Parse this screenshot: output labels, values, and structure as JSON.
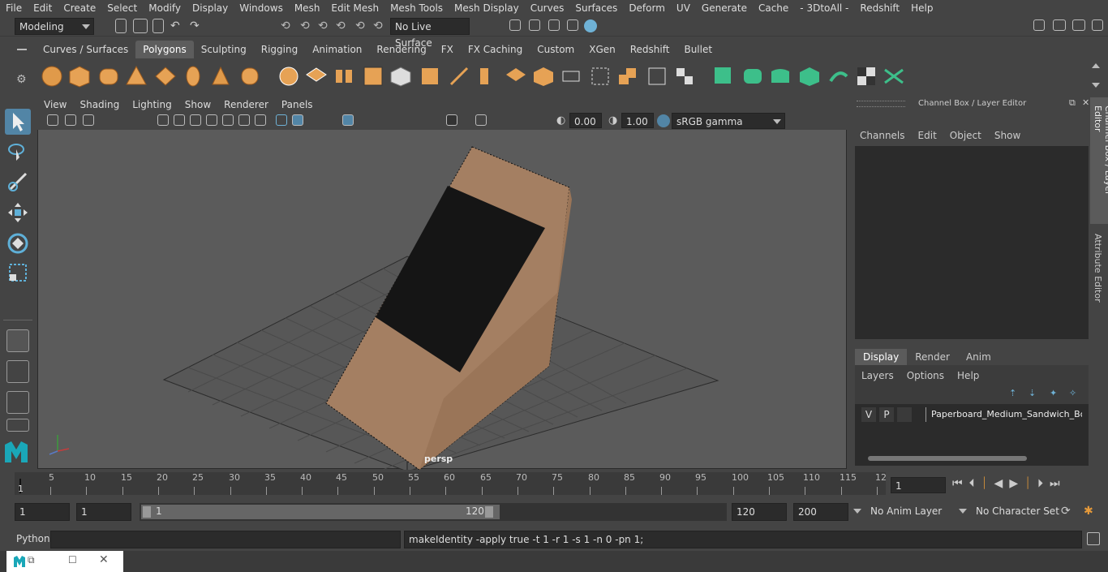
{
  "menubar": [
    "File",
    "Edit",
    "Create",
    "Select",
    "Modify",
    "Display",
    "Windows",
    "Mesh",
    "Edit Mesh",
    "Mesh Tools",
    "Mesh Display",
    "Curves",
    "Surfaces",
    "Deform",
    "UV",
    "Generate",
    "Cache",
    "- 3DtoAll -",
    "Redshift",
    "Help"
  ],
  "status": {
    "mode": "Modeling",
    "live_surface": "No Live Surface"
  },
  "shelf_tabs": [
    "Curves / Surfaces",
    "Polygons",
    "Sculpting",
    "Rigging",
    "Animation",
    "Rendering",
    "FX",
    "FX Caching",
    "Custom",
    "XGen",
    "Redshift",
    "Bullet"
  ],
  "viewport": {
    "menus": [
      "View",
      "Shading",
      "Lighting",
      "Show",
      "Renderer",
      "Panels"
    ],
    "exposure": "0.00",
    "gamma": "1.00",
    "color_space": "sRGB gamma",
    "camera_label": "persp"
  },
  "channel_box": {
    "title": "Channel Box / Layer Editor",
    "menus": [
      "Channels",
      "Edit",
      "Object",
      "Show"
    ],
    "side_tabs": [
      "Channel Box / Layer Editor",
      "Attribute Editor"
    ],
    "layer_tabs": [
      "Display",
      "Render",
      "Anim"
    ],
    "layer_menus": [
      "Layers",
      "Options",
      "Help"
    ],
    "layer": {
      "v": "V",
      "p": "P",
      "name": "Paperboard_Medium_Sandwich_Box_"
    }
  },
  "timeline": {
    "ticks": [
      "5",
      "10",
      "15",
      "20",
      "25",
      "30",
      "35",
      "40",
      "45",
      "50",
      "55",
      "60",
      "65",
      "70",
      "75",
      "80",
      "85",
      "90",
      "95",
      "100",
      "105",
      "110",
      "115",
      "12"
    ],
    "start_label": "1",
    "current_frame": "1"
  },
  "range": {
    "start": "1",
    "playback_start": "1",
    "slider_start": "1",
    "slider_end": "120",
    "playback_end": "120",
    "end": "200",
    "anim_layer": "No Anim Layer",
    "character_set": "No Character Set"
  },
  "command": {
    "lang": "Python",
    "output": "makeIdentity -apply true -t 1 -r 1 -s 1 -n 0 -pn 1;"
  },
  "colors": {
    "bg": "#444444",
    "viewport": "#5b5b5b",
    "accent": "#5285a6",
    "box": "#a47f62"
  }
}
